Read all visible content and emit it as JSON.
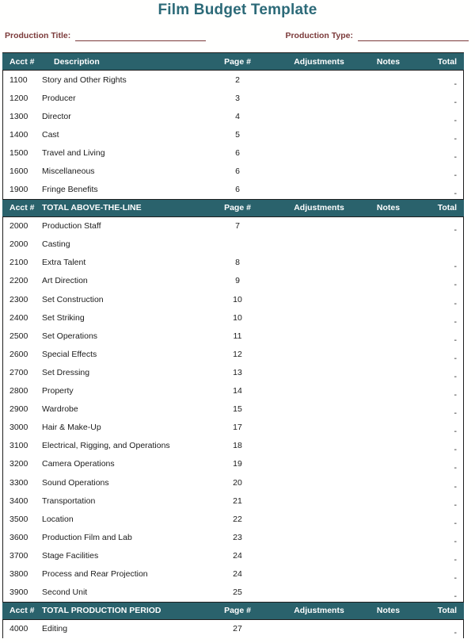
{
  "document": {
    "title": "Film Budget Template",
    "title_color": "#2c6a78",
    "label_color": "#7b3a3a",
    "header_bg": "#2a626c"
  },
  "fields": [
    {
      "label": "Production Title:",
      "value": ""
    },
    {
      "label": "Production Type:",
      "value": ""
    }
  ],
  "columns": {
    "acct": "Acct #",
    "description": "Description",
    "page": "Page #",
    "adjustments": "Adjustments",
    "notes": "Notes",
    "total": "Total"
  },
  "sections": [
    {
      "header": {
        "acct": "Acct #",
        "description": "Description",
        "page": "Page #",
        "adjustments": "Adjustments",
        "notes": "Notes",
        "total": "Total"
      },
      "rows": [
        {
          "acct": "1100",
          "description": "Story and Other Rights",
          "page": "2",
          "adjustments": "",
          "notes": "",
          "total": "-"
        },
        {
          "acct": "1200",
          "description": "Producer",
          "page": "3",
          "adjustments": "",
          "notes": "",
          "total": "-"
        },
        {
          "acct": "1300",
          "description": "Director",
          "page": "4",
          "adjustments": "",
          "notes": "",
          "total": "-"
        },
        {
          "acct": "1400",
          "description": "Cast",
          "page": "5",
          "adjustments": "",
          "notes": "",
          "total": "-"
        },
        {
          "acct": "1500",
          "description": "Travel and Living",
          "page": "6",
          "adjustments": "",
          "notes": "",
          "total": "-"
        },
        {
          "acct": "1600",
          "description": "Miscellaneous",
          "page": "6",
          "adjustments": "",
          "notes": "",
          "total": "-"
        },
        {
          "acct": "1900",
          "description": "Fringe Benefits",
          "page": "6",
          "adjustments": "",
          "notes": "",
          "total": "-"
        }
      ]
    },
    {
      "header": {
        "acct": "Acct #",
        "description": "TOTAL ABOVE-THE-LINE",
        "page": "Page #",
        "adjustments": "Adjustments",
        "notes": "Notes",
        "total": "Total"
      },
      "rows": [
        {
          "acct": "2000",
          "description": "Production Staff",
          "page": "7",
          "adjustments": "",
          "notes": "",
          "total": "-"
        },
        {
          "acct": "2000",
          "description": "Casting",
          "page": "",
          "adjustments": "",
          "notes": "",
          "total": ""
        },
        {
          "acct": "2100",
          "description": "Extra Talent",
          "page": "8",
          "adjustments": "",
          "notes": "",
          "total": "-"
        },
        {
          "acct": "2200",
          "description": "Art Direction",
          "page": "9",
          "adjustments": "",
          "notes": "",
          "total": "-"
        },
        {
          "acct": "2300",
          "description": "Set Construction",
          "page": "10",
          "adjustments": "",
          "notes": "",
          "total": "-"
        },
        {
          "acct": "2400",
          "description": "Set Striking",
          "page": "10",
          "adjustments": "",
          "notes": "",
          "total": "-"
        },
        {
          "acct": "2500",
          "description": "Set Operations",
          "page": "11",
          "adjustments": "",
          "notes": "",
          "total": "-"
        },
        {
          "acct": "2600",
          "description": "Special Effects",
          "page": "12",
          "adjustments": "",
          "notes": "",
          "total": "-"
        },
        {
          "acct": "2700",
          "description": "Set Dressing",
          "page": "13",
          "adjustments": "",
          "notes": "",
          "total": "-"
        },
        {
          "acct": "2800",
          "description": "Property",
          "page": "14",
          "adjustments": "",
          "notes": "",
          "total": "-"
        },
        {
          "acct": "2900",
          "description": "Wardrobe",
          "page": "15",
          "adjustments": "",
          "notes": "",
          "total": "-"
        },
        {
          "acct": "3000",
          "description": "Hair & Make-Up",
          "page": "17",
          "adjustments": "",
          "notes": "",
          "total": "-"
        },
        {
          "acct": "3100",
          "description": "Electrical, Rigging, and Operations",
          "page": "18",
          "adjustments": "",
          "notes": "",
          "total": "-"
        },
        {
          "acct": "3200",
          "description": "Camera Operations",
          "page": "19",
          "adjustments": "",
          "notes": "",
          "total": "-"
        },
        {
          "acct": "3300",
          "description": "Sound Operations",
          "page": "20",
          "adjustments": "",
          "notes": "",
          "total": "-"
        },
        {
          "acct": "3400",
          "description": "Transportation",
          "page": "21",
          "adjustments": "",
          "notes": "",
          "total": "-"
        },
        {
          "acct": "3500",
          "description": "Location",
          "page": "22",
          "adjustments": "",
          "notes": "",
          "total": "-"
        },
        {
          "acct": "3600",
          "description": "Production Film and Lab",
          "page": "23",
          "adjustments": "",
          "notes": "",
          "total": "-"
        },
        {
          "acct": "3700",
          "description": "Stage Facilities",
          "page": "24",
          "adjustments": "",
          "notes": "",
          "total": "-"
        },
        {
          "acct": "3800",
          "description": "Process and Rear Projection",
          "page": "24",
          "adjustments": "",
          "notes": "",
          "total": "-"
        },
        {
          "acct": "3900",
          "description": "Second Unit",
          "page": "25",
          "adjustments": "",
          "notes": "",
          "total": "-"
        }
      ]
    },
    {
      "header": {
        "acct": "Acct #",
        "description": "TOTAL PRODUCTION PERIOD",
        "page": "Page #",
        "adjustments": "Adjustments",
        "notes": "Notes",
        "total": "Total"
      },
      "rows": [
        {
          "acct": "4000",
          "description": "Editing",
          "page": "27",
          "adjustments": "",
          "notes": "",
          "total": "-"
        }
      ]
    }
  ]
}
